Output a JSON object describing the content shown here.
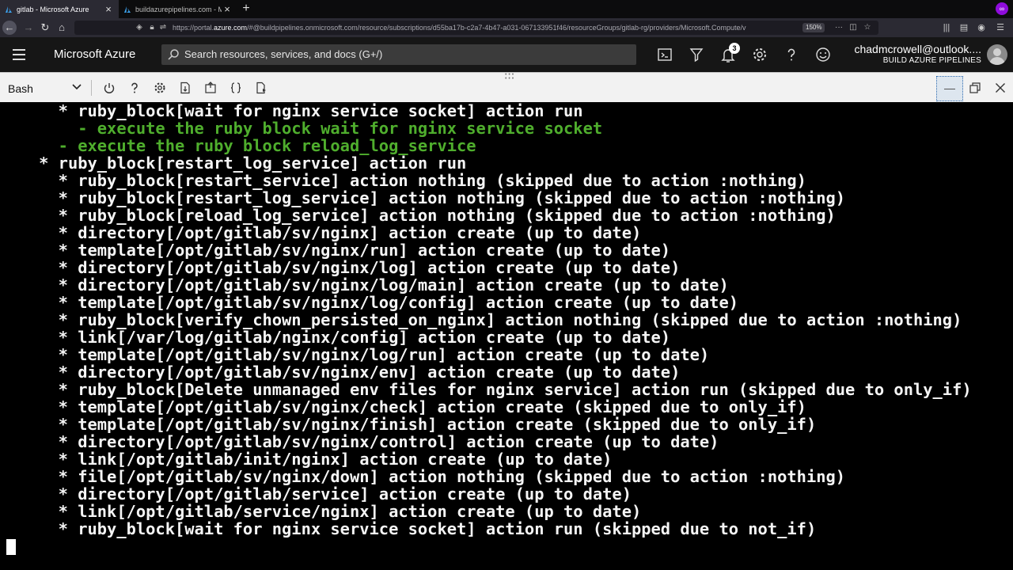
{
  "browser": {
    "tabs": [
      {
        "title": "gitlab - Microsoft Azure",
        "active": true
      },
      {
        "title": "buildazurepipelines.com - Micr",
        "active": false
      }
    ],
    "url_prefix": "https://portal.",
    "url_domain": "azure.com",
    "url_rest": "/#@buildpipelines.onmicrosoft.com/resource/subscriptions/d55ba17b-c2a7-4b47-a031-067133951f46/resourceGroups/gitlab-rg/providers/Microsoft.Compute/v",
    "zoom": "150%"
  },
  "header": {
    "brand": "Microsoft Azure",
    "search_placeholder": "Search resources, services, and docs (G+/)",
    "notification_count": "3",
    "account_email": "chadmcrowell@outlook....",
    "account_org": "BUILD AZURE PIPELINES"
  },
  "shell": {
    "type": "Bash"
  },
  "terminal": {
    "lines": [
      {
        "indent": "      ",
        "text": "* ruby_block[wait for nginx service socket] action run",
        "color": "white"
      },
      {
        "indent": "        ",
        "text": "- execute the ruby block wait for nginx service socket",
        "color": "green"
      },
      {
        "indent": "      ",
        "text": "- execute the ruby block reload_log_service",
        "color": "green"
      },
      {
        "indent": "    ",
        "text": "* ruby_block[restart_log_service] action run",
        "color": "white"
      },
      {
        "indent": "      ",
        "text": "* ruby_block[restart_service] action nothing (skipped due to action :nothing)",
        "color": "white"
      },
      {
        "indent": "      ",
        "text": "* ruby_block[restart_log_service] action nothing (skipped due to action :nothing)",
        "color": "white"
      },
      {
        "indent": "      ",
        "text": "* ruby_block[reload_log_service] action nothing (skipped due to action :nothing)",
        "color": "white"
      },
      {
        "indent": "      ",
        "text": "* directory[/opt/gitlab/sv/nginx] action create (up to date)",
        "color": "white"
      },
      {
        "indent": "      ",
        "text": "* template[/opt/gitlab/sv/nginx/run] action create (up to date)",
        "color": "white"
      },
      {
        "indent": "      ",
        "text": "* directory[/opt/gitlab/sv/nginx/log] action create (up to date)",
        "color": "white"
      },
      {
        "indent": "      ",
        "text": "* directory[/opt/gitlab/sv/nginx/log/main] action create (up to date)",
        "color": "white"
      },
      {
        "indent": "      ",
        "text": "* template[/opt/gitlab/sv/nginx/log/config] action create (up to date)",
        "color": "white"
      },
      {
        "indent": "      ",
        "text": "* ruby_block[verify_chown_persisted_on_nginx] action nothing (skipped due to action :nothing)",
        "color": "white"
      },
      {
        "indent": "      ",
        "text": "* link[/var/log/gitlab/nginx/config] action create (up to date)",
        "color": "white"
      },
      {
        "indent": "      ",
        "text": "* template[/opt/gitlab/sv/nginx/log/run] action create (up to date)",
        "color": "white"
      },
      {
        "indent": "      ",
        "text": "* directory[/opt/gitlab/sv/nginx/env] action create (up to date)",
        "color": "white"
      },
      {
        "indent": "      ",
        "text": "* ruby_block[Delete unmanaged env files for nginx service] action run (skipped due to only_if)",
        "color": "white"
      },
      {
        "indent": "      ",
        "text": "* template[/opt/gitlab/sv/nginx/check] action create (skipped due to only_if)",
        "color": "white"
      },
      {
        "indent": "      ",
        "text": "* template[/opt/gitlab/sv/nginx/finish] action create (skipped due to only_if)",
        "color": "white"
      },
      {
        "indent": "      ",
        "text": "* directory[/opt/gitlab/sv/nginx/control] action create (up to date)",
        "color": "white"
      },
      {
        "indent": "      ",
        "text": "* link[/opt/gitlab/init/nginx] action create (up to date)",
        "color": "white"
      },
      {
        "indent": "      ",
        "text": "* file[/opt/gitlab/sv/nginx/down] action nothing (skipped due to action :nothing)",
        "color": "white"
      },
      {
        "indent": "      ",
        "text": "* directory[/opt/gitlab/service] action create (up to date)",
        "color": "white"
      },
      {
        "indent": "      ",
        "text": "* link[/opt/gitlab/service/nginx] action create (up to date)",
        "color": "white"
      },
      {
        "indent": "      ",
        "text": "* ruby_block[wait for nginx service socket] action run (skipped due to not_if)",
        "color": "white"
      }
    ]
  }
}
